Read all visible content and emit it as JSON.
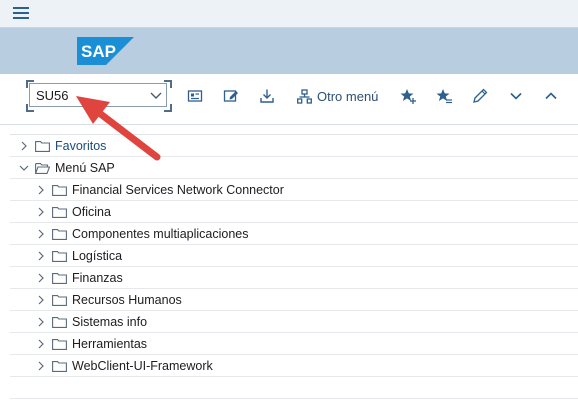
{
  "titlebar": {
    "menu_icon": "hamburger-menu-icon"
  },
  "banner": {
    "logo_text": "SAP",
    "logo_color": "#1a8fd6"
  },
  "toolbar": {
    "command_field": {
      "value": "SU56"
    },
    "icons": [
      "display-icon",
      "edit-icon",
      "download-icon"
    ],
    "otro_menu_label": "Otro menú",
    "right_icons": [
      "add-favorite-icon",
      "manage-favorites-icon",
      "pencil-icon",
      "chevron-down-icon",
      "chevron-up-icon"
    ]
  },
  "tree": {
    "favorites_label": "Favoritos",
    "sap_menu_label": "Menú SAP",
    "items": [
      {
        "label": "Financial Services Network Connector"
      },
      {
        "label": "Oficina"
      },
      {
        "label": "Componentes multiaplicaciones"
      },
      {
        "label": "Logística"
      },
      {
        "label": "Finanzas"
      },
      {
        "label": "Recursos Humanos"
      },
      {
        "label": "Sistemas info"
      },
      {
        "label": "Herramientas"
      },
      {
        "label": "WebClient-UI-Framework"
      }
    ]
  },
  "annotation": {
    "arrow_color": "#e0443e"
  }
}
